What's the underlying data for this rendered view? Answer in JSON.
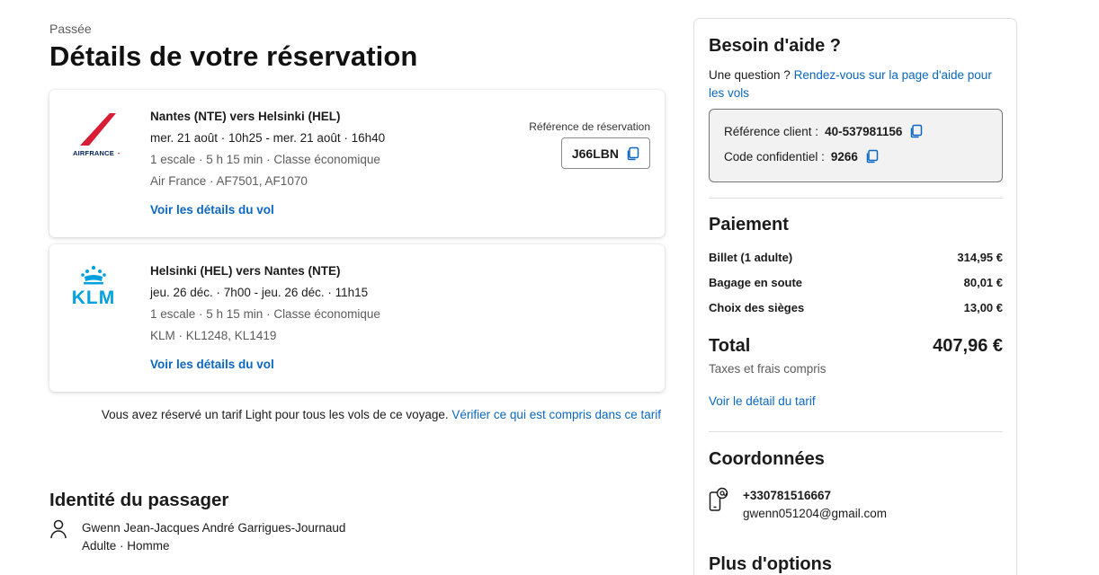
{
  "header": {
    "status": "Passée",
    "title": "Détails de votre réservation"
  },
  "flights": [
    {
      "airline_logo": "airfrance-logo",
      "route": "Nantes (NTE) vers Helsinki (HEL)",
      "dates": "mer. 21 août · 10h25 - mer. 21 août · 16h40",
      "stops": "1 escale · 5 h 15 min · Classe économique",
      "carrier": "Air France · AF7501, AF1070",
      "details_link": "Voir les détails du vol",
      "ref_label": "Référence de réservation",
      "ref_code": "J66LBN"
    },
    {
      "airline_logo": "klm-logo",
      "route": "Helsinki (HEL) vers Nantes (NTE)",
      "dates": "jeu. 26 déc. · 7h00 - jeu. 26 déc. · 11h15",
      "stops": "1 escale · 5 h 15 min · Classe économique",
      "carrier": "KLM · KL1248, KL1419",
      "details_link": "Voir les détails du vol"
    }
  ],
  "fare_note": {
    "text": "Vous avez réservé un tarif Light pour tous les vols de ce voyage.",
    "link": "Vérifier ce qui est compris dans ce tarif"
  },
  "passenger": {
    "section_title": "Identité du passager",
    "name": "Gwenn Jean-Jacques André Garrigues-Journaud",
    "details": "Adulte · Homme"
  },
  "sidebar": {
    "help": {
      "title": "Besoin d'aide ?",
      "question": "Une question ?",
      "link": "Rendez-vous sur la page d'aide pour les vols",
      "client_ref_label": "Référence client :",
      "client_ref_value": "40-537981156",
      "code_label": "Code confidentiel :",
      "code_value": "9266"
    },
    "payment": {
      "title": "Paiement",
      "items": [
        {
          "label": "Billet (1 adulte)",
          "amount": "314,95 €"
        },
        {
          "label": "Bagage en soute",
          "amount": "80,01 €"
        },
        {
          "label": "Choix des sièges",
          "amount": "13,00 €"
        }
      ],
      "total_label": "Total",
      "total_amount": "407,96 €",
      "taxes_note": "Taxes et frais compris",
      "fare_detail_link": "Voir le détail du tarif"
    },
    "contact": {
      "title": "Coordonnées",
      "phone": "+330781516667",
      "email": "gwenn051204@gmail.com"
    },
    "more_options_title": "Plus d'options"
  },
  "colors": {
    "link": "#0b67c2",
    "airfrance_red": "#d81e35",
    "airfrance_navy": "#002157",
    "klm_blue": "#00a1de"
  }
}
